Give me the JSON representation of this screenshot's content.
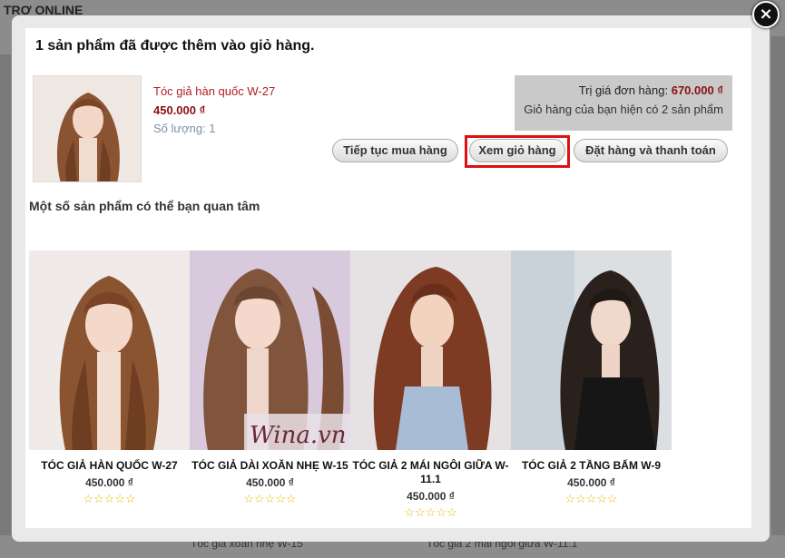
{
  "background": {
    "header_text": "TRƠ ONLINE",
    "footer_items": [
      "Tóc giả xoăn nhẹ W-15",
      "Tóc giả 2 mái ngôi giữa W-11.1"
    ]
  },
  "modal": {
    "close_label": "×",
    "notice": "1 sản phẩm đã được thêm vào giỏ hàng.",
    "added_product": {
      "name": "Tóc giả hàn quốc W-27",
      "price": "450.000 ₫",
      "quantity": "Số lượng: 1"
    },
    "summary": {
      "order_value_label": "Trị giá đơn hàng:",
      "order_value": "670.000 ₫",
      "cart_count_text": "Giỏ hàng của bạn hiện có 2 sản phẩm"
    },
    "buttons": {
      "continue_shopping": "Tiếp tục mua hàng",
      "view_cart": "Xem giỏ hàng",
      "checkout": "Đặt hàng và thanh toán"
    },
    "suggestions_title": "Một số sản phẩm có thể bạn quan tâm",
    "suggestions": [
      {
        "name": "TÓC GIẢ HÀN QUỐC W-27",
        "price": "450.000 ₫",
        "stars": "☆☆☆☆☆",
        "image_icon": "wig-photo-1"
      },
      {
        "name": "TÓC GIẢ DÀI XOĂN NHẸ W-15",
        "price": "450.000 ₫",
        "stars": "☆☆☆☆☆",
        "image_icon": "wig-photo-2"
      },
      {
        "name": "TÓC GIẢ 2 MÁI NGÔI GIỮA W-11.1",
        "price": "450.000 ₫",
        "stars": "☆☆☆☆☆",
        "image_icon": "wig-photo-3"
      },
      {
        "name": "TÓC GIẢ 2 TẦNG BẤM W-9",
        "price": "450.000 ₫",
        "stars": "☆☆☆☆☆",
        "image_icon": "wig-photo-4"
      }
    ],
    "watermark": "Wina.vn"
  },
  "colors": {
    "accent_red": "#b01e23",
    "price_red": "#8a1010",
    "highlight_border": "#e01010",
    "star_yellow": "#e6b800"
  }
}
